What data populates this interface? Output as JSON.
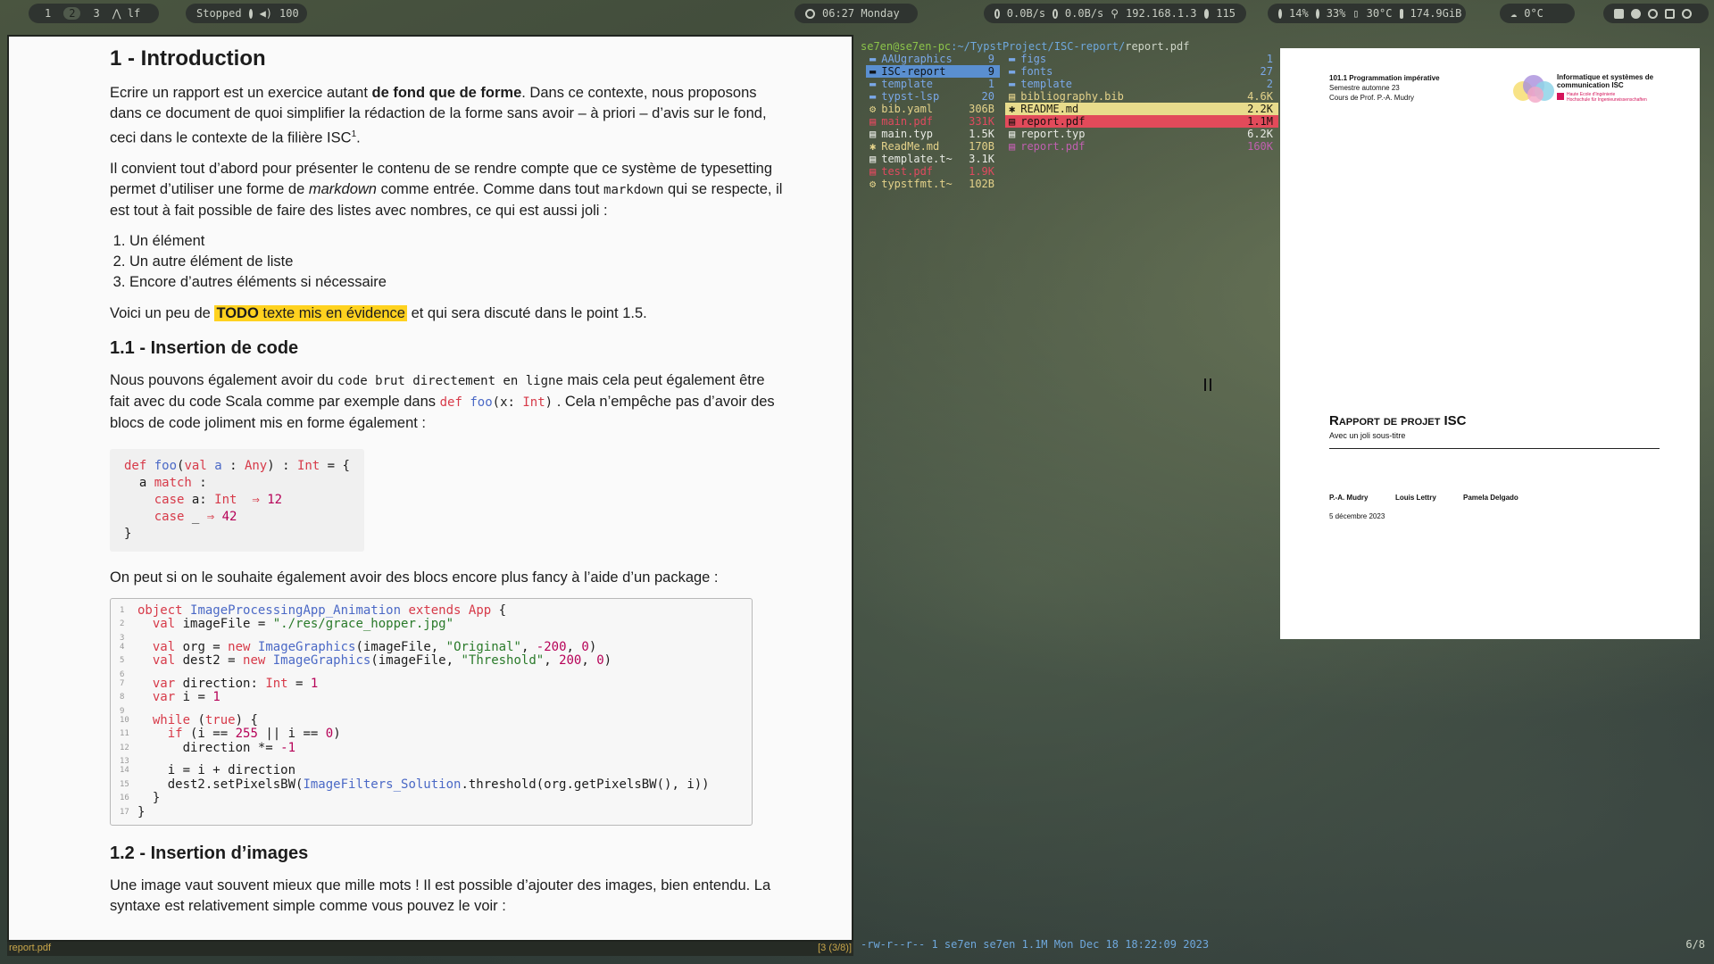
{
  "topbar": {
    "workspaces": [
      "1",
      "2",
      "3"
    ],
    "active_workspace": "2",
    "app_name": "lf",
    "player": {
      "state": "Stopped",
      "volume": "100"
    },
    "clock": "06:27 Monday",
    "net": {
      "down": "0.0B/s",
      "up": "0.0B/s",
      "ip": "192.168.1.3",
      "count": "115"
    },
    "sys": {
      "cpu": "14%",
      "mem": "33%",
      "temp": "30°C",
      "disk": "174.9GiB"
    },
    "weather": "0°C"
  },
  "pdf": {
    "h1": "1 - Introduction",
    "p1": {
      "a": "Ecrire un rapport est un exercice autant ",
      "b": "de fond que de forme",
      "c": ". Dans ce contexte, nous proposons dans ce document de quoi simplifier la rédaction de la forme sans avoir – à priori – d’avis sur le fond, ceci dans le contexte de la filière ISC",
      "sup": "1",
      "d": "."
    },
    "p2": {
      "a": "Il convient tout d’abord pour présenter le contenu de se rendre compte que ce système de typesetting permet d’utiliser une forme de ",
      "em": "markdown",
      "b": " comme entrée. Comme dans tout ",
      "code": "markdown",
      "c": " qui se respecte, il est tout à fait possible de faire des listes avec nombres, ce qui est aussi joli :"
    },
    "list": [
      "Un élément",
      "Un autre élément de liste",
      "Encore d’autres éléments si nécessaire"
    ],
    "p3": {
      "a": "Voici un peu de ",
      "todo": "TODO",
      "hl": " texte mis en évidence",
      "b": " et qui sera discuté dans le point 1.5."
    },
    "h2a": "1.1 - Insertion de code",
    "p4": {
      "a": "Nous pouvons également avoir du ",
      "code": "code brut directement en ligne",
      "b": " mais cela peut également être fait avec du code Scala comme par exemple dans ",
      "c": ". Cela n’empêche pas d’avoir des blocs de code joliment mis en forme également :"
    },
    "p5": "On peut si on le souhaite également avoir des blocs encore plus fancy à l’aide d’un package :",
    "h2b": "1.2 - Insertion d’images",
    "p6": "Une image vaut souvent mieux que mille mots ! Il est possible d’ajouter des images, bien entendu. La syntaxe est relativement simple comme vous pouvez le voir :",
    "code_lines": [
      "object ImageProcessingApp_Animation extends App {",
      "  val imageFile = \"./res/grace_hopper.jpg\"",
      "",
      "  val org = new ImageGraphics(imageFile, \"Original\", -200, 0)",
      "  val dest2 = new ImageGraphics(imageFile, \"Threshold\", 200, 0)",
      "",
      "  var direction: Int = 1",
      "  var i = 1",
      "",
      "  while (true) {",
      "    if (i == 255 || i == 0)",
      "      direction *= -1",
      "",
      "    i = i + direction",
      "    dest2.setPixelsBW(ImageFilters_Solution.threshold(org.getPixelsBW(), i))",
      "  }",
      "}"
    ],
    "status_left": "report.pdf",
    "status_right": "[3 (3/8)]"
  },
  "fm": {
    "path_user": "se7en@se7en-pc",
    "path_dir": ":~/TypstProject/ISC-report/",
    "path_file": "report.pdf",
    "col1": [
      {
        "name": "AAUgraphics",
        "size": "9",
        "cls": "dir",
        "icon": "folder-icon"
      },
      {
        "name": "ISC-report",
        "size": "9",
        "cls": "sel-blue",
        "icon": "folder-icon"
      },
      {
        "name": "template",
        "size": "1",
        "cls": "dir",
        "icon": "folder-icon"
      },
      {
        "name": "typst-lsp",
        "size": "20",
        "cls": "dir",
        "icon": "folder-icon"
      },
      {
        "name": "bib.yaml",
        "size": "306B",
        "cls": "file-y",
        "icon": "gear-icon"
      },
      {
        "name": "main.pdf",
        "size": "331K",
        "cls": "file-r",
        "icon": "pdf-icon"
      },
      {
        "name": "main.typ",
        "size": "1.5K",
        "cls": "file-w",
        "icon": "file-icon"
      },
      {
        "name": "ReadMe.md",
        "size": "170B",
        "cls": "file-y",
        "icon": "markdown-icon"
      },
      {
        "name": "template.t~",
        "size": "3.1K",
        "cls": "file-w",
        "icon": "file-icon"
      },
      {
        "name": "test.pdf",
        "size": "1.9K",
        "cls": "file-r",
        "icon": "pdf-icon"
      },
      {
        "name": "typstfmt.t~",
        "size": "102B",
        "cls": "file-y",
        "icon": "gear-icon"
      }
    ],
    "col2": [
      {
        "name": "figs",
        "size": "1",
        "cls": "dir",
        "icon": "folder-icon"
      },
      {
        "name": "fonts",
        "size": "27",
        "cls": "dir",
        "icon": "folder-icon"
      },
      {
        "name": "template",
        "size": "2",
        "cls": "dir",
        "icon": "folder-icon"
      },
      {
        "name": "bibliography.bib",
        "size": "4.6K",
        "cls": "file-y",
        "icon": "file-icon"
      },
      {
        "name": "README.md",
        "size": "2.2K",
        "cls": "sel-yellow",
        "icon": "markdown-icon"
      },
      {
        "name": "report.pdf",
        "size": "1.1M",
        "cls": "sel-red",
        "icon": "pdf-icon"
      },
      {
        "name": "report.typ",
        "size": "6.2K",
        "cls": "file-w",
        "icon": "file-icon"
      },
      {
        "name": "report.pdf",
        "size": "160K",
        "cls": "file-p",
        "icon": "pdf-icon"
      }
    ],
    "status_left": "-rw-r--r--  1 se7en se7en 1.1M Mon Dec 18 18:22:09 2023",
    "status_right": "6/8"
  },
  "preview": {
    "course_code": "101.1 Programmation impérative",
    "semester": "Semestre automne 23",
    "professor": "Cours de Prof. P.-A. Mudry",
    "dept": "Informatique et systèmes de communication ISC",
    "school_1": "Haute Ecole d'Ingénierie",
    "school_2": "Hochschule für Ingenieurwissenschaften",
    "title": "Rapport de projet ISC",
    "subtitle": "Avec un joli sous-titre",
    "authors": [
      "P.-A. Mudry",
      "Louis Lettry",
      "Pamela Delgado"
    ],
    "date": "5 décembre 2023"
  }
}
